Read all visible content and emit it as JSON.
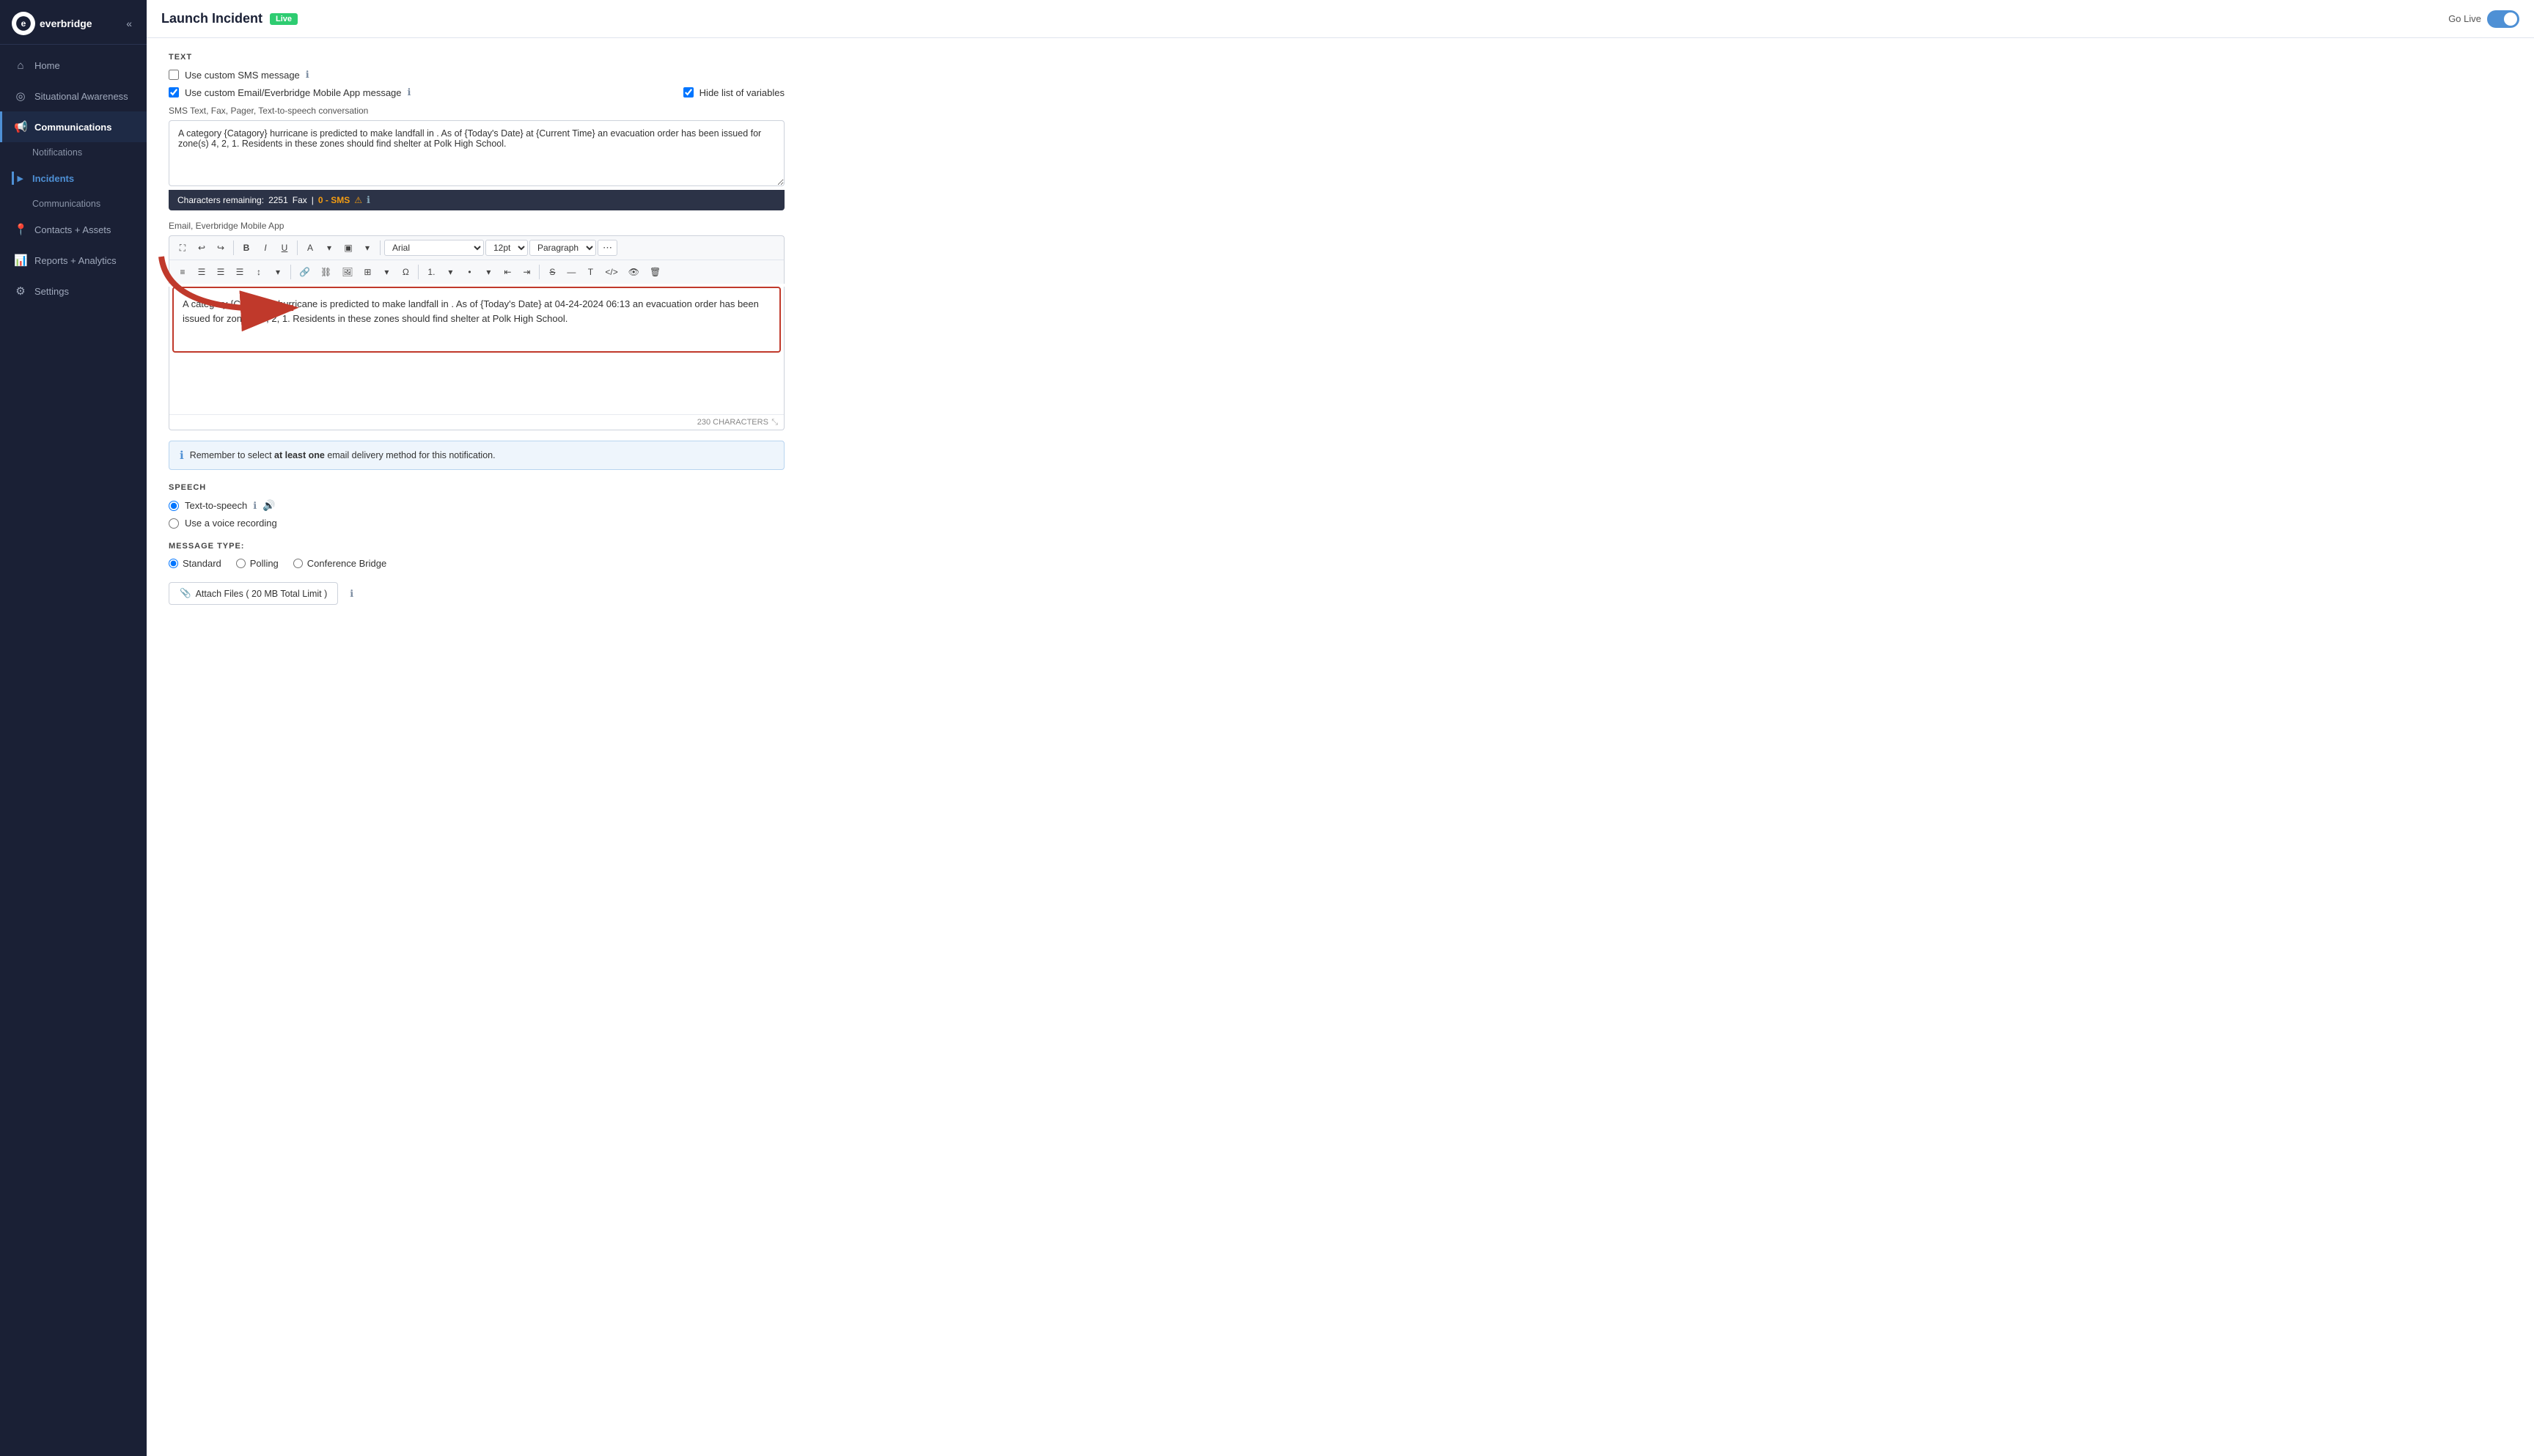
{
  "sidebar": {
    "logo": "everbridge",
    "collapse_label": "«",
    "nav": [
      {
        "id": "home",
        "label": "Home",
        "icon": "⌂",
        "active": false
      },
      {
        "id": "situational-awareness",
        "label": "Situational Awareness",
        "icon": "◎",
        "active": false
      },
      {
        "id": "communications",
        "label": "Communications",
        "icon": "📢",
        "active": true,
        "sub": [
          {
            "id": "notifications",
            "label": "Notifications",
            "active": false
          }
        ]
      },
      {
        "id": "incidents",
        "label": "Incidents",
        "active": true,
        "sub": [
          {
            "id": "communications-sub",
            "label": "Communications",
            "active": false
          }
        ]
      },
      {
        "id": "contacts-assets",
        "label": "Contacts + Assets",
        "icon": "📍",
        "active": false
      },
      {
        "id": "reports-analytics",
        "label": "Reports + Analytics",
        "icon": "📊",
        "active": false
      },
      {
        "id": "settings",
        "label": "Settings",
        "icon": "⚙",
        "active": false
      }
    ]
  },
  "topbar": {
    "title": "Launch Incident",
    "live_badge": "Live",
    "go_live_label": "Go Live"
  },
  "content": {
    "section_text_label": "TEXT",
    "checkbox_sms": {
      "label": "Use custom SMS message",
      "checked": false
    },
    "checkbox_email": {
      "label": "Use custom Email/Everbridge Mobile App message",
      "checked": true
    },
    "checkbox_hide_vars": {
      "label": "Hide list of variables",
      "checked": true
    },
    "sms_section_label": "SMS Text, Fax, Pager, Text-to-speech conversation",
    "sms_textarea_value": "A category {Catagory} hurricane is predicted to make landfall in . As of {Today's Date} at {Current Time} an evacuation order has been issued for zone(s) 4, 2, 1. Residents in these zones should find shelter at Polk High School.",
    "chars_remaining_label": "Characters remaining:",
    "chars_remaining_count": "2251",
    "fax_label": "Fax",
    "sms_count_label": "0 - SMS",
    "email_section_label": "Email, Everbridge Mobile App",
    "toolbar": {
      "font_name": "Arial",
      "font_size": "12pt",
      "paragraph": "Paragraph"
    },
    "editor_content": "A category {Catagory} hurricane is predicted to make landfall in . As of {Today's Date} at 04-24-2024 06:13 an evacuation order has been issued for zone(s) 4, 2, 1. Residents in these zones should find shelter at Polk High School.",
    "char_count_label": "230 CHARACTERS",
    "info_box_text": "Remember to select",
    "info_box_bold": "at least one",
    "info_box_suffix": "email delivery method for this notification.",
    "speech_section_label": "SPEECH",
    "radio_tts": {
      "label": "Text-to-speech",
      "checked": true
    },
    "radio_voice": {
      "label": "Use a voice recording",
      "checked": false
    },
    "msg_type_label": "MESSAGE TYPE:",
    "radio_standard": {
      "label": "Standard",
      "checked": true
    },
    "radio_polling": {
      "label": "Polling",
      "checked": false
    },
    "radio_conference": {
      "label": "Conference Bridge",
      "checked": false
    },
    "attach_btn_label": "Attach Files ( 20 MB Total Limit )"
  }
}
